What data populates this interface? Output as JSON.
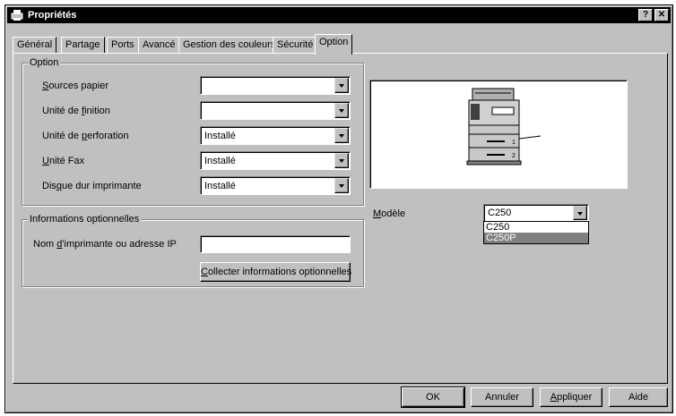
{
  "window": {
    "title": "Propriétés",
    "help_button": "?",
    "close_button": "✕"
  },
  "tabs": [
    {
      "label": "Général",
      "active": false
    },
    {
      "label": "Partage",
      "active": false
    },
    {
      "label": "Ports",
      "active": false
    },
    {
      "label": "Avancé",
      "active": false
    },
    {
      "label": "Gestion des couleurs",
      "active": false
    },
    {
      "label": "Sécurité",
      "active": false
    },
    {
      "label": "Option",
      "active": true
    }
  ],
  "option_group": {
    "title": "Option",
    "rows": [
      {
        "label_prefix": "",
        "label_underline": "S",
        "label_rest": "ources papier",
        "value": ""
      },
      {
        "label_prefix": "Unité de ",
        "label_underline": "f",
        "label_rest": "inition",
        "value": ""
      },
      {
        "label_prefix": "Unité de ",
        "label_underline": "p",
        "label_rest": "erforation",
        "value": "Installé"
      },
      {
        "label_prefix": "",
        "label_underline": "U",
        "label_rest": "nité Fax",
        "value": "Installé"
      },
      {
        "label_prefix": "Dis",
        "label_underline": "q",
        "label_rest": "ue dur imprimante",
        "value": "Installé"
      }
    ]
  },
  "info_group": {
    "title": "Informations optionnelles",
    "printer_label_prefix": "Nom ",
    "printer_label_underline": "d",
    "printer_label_rest": "'imprimante ou adresse IP",
    "printer_value": "",
    "collect_underline": "C",
    "collect_rest": "ollecter informations optionnelles"
  },
  "model": {
    "label_underline": "M",
    "label_rest": "odèle",
    "selected": "C250",
    "options": [
      "C250",
      "C250P"
    ],
    "highlighted_option": "C250P"
  },
  "preview": {
    "tray_labels": [
      "1",
      "2"
    ]
  },
  "footer": {
    "ok": "OK",
    "cancel": "Annuler",
    "apply_underline": "A",
    "apply_rest": "ppliquer",
    "help": "Aide"
  }
}
